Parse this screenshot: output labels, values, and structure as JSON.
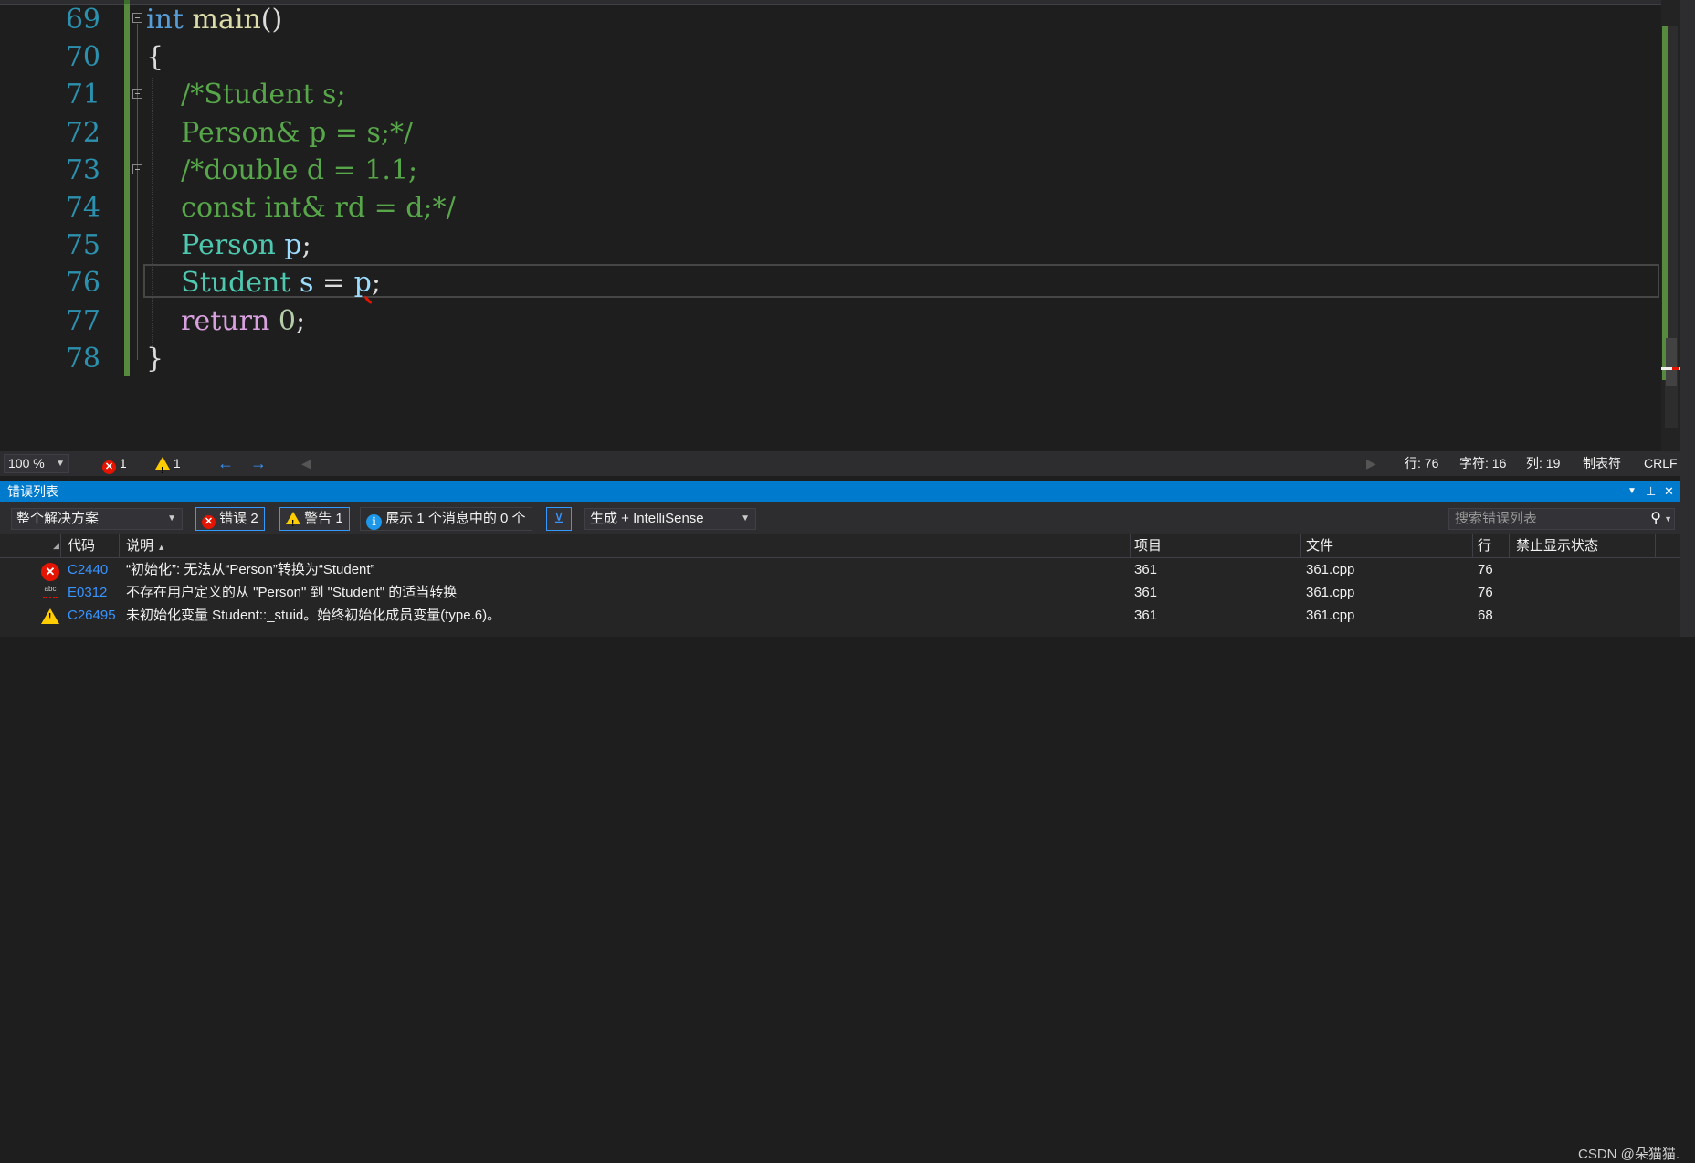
{
  "editor": {
    "lines": [
      {
        "num": "69",
        "tokens": [
          {
            "t": "int",
            "c": "kw"
          },
          {
            "t": " ",
            "c": ""
          },
          {
            "t": "main",
            "c": "fn"
          },
          {
            "t": "()",
            "c": ""
          }
        ]
      },
      {
        "num": "70",
        "tokens": [
          {
            "t": "{",
            "c": ""
          }
        ]
      },
      {
        "num": "71",
        "tokens": [
          {
            "t": "    /*Student s;",
            "c": "cm"
          }
        ]
      },
      {
        "num": "72",
        "tokens": [
          {
            "t": "    Person& p = s;*/",
            "c": "cm"
          }
        ]
      },
      {
        "num": "73",
        "tokens": [
          {
            "t": "    /*double d = 1.1;",
            "c": "cm"
          }
        ]
      },
      {
        "num": "74",
        "tokens": [
          {
            "t": "    const int& rd = d;*/",
            "c": "cm"
          }
        ]
      },
      {
        "num": "75",
        "tokens": [
          {
            "t": "    ",
            "c": ""
          },
          {
            "t": "Person",
            "c": "ty"
          },
          {
            "t": " ",
            "c": ""
          },
          {
            "t": "p",
            "c": "var"
          },
          {
            "t": ";",
            "c": ""
          }
        ]
      },
      {
        "num": "76",
        "tokens": [
          {
            "t": "    ",
            "c": ""
          },
          {
            "t": "Student",
            "c": "ty"
          },
          {
            "t": " ",
            "c": ""
          },
          {
            "t": "s",
            "c": "var"
          },
          {
            "t": " = ",
            "c": ""
          },
          {
            "t": "p",
            "c": "var"
          },
          {
            "t": ";",
            "c": ""
          }
        ]
      },
      {
        "num": "77",
        "tokens": [
          {
            "t": "    ",
            "c": ""
          },
          {
            "t": "return",
            "c": "ctl"
          },
          {
            "t": " ",
            "c": ""
          },
          {
            "t": "0",
            "c": "num"
          },
          {
            "t": ";",
            "c": ""
          }
        ]
      },
      {
        "num": "78",
        "tokens": [
          {
            "t": "}",
            "c": ""
          }
        ]
      }
    ]
  },
  "statusbar": {
    "zoom": "100 %",
    "errors": "1",
    "warnings": "1",
    "line": "行: 76",
    "char": "字符: 16",
    "col": "列: 19",
    "tabs": "制表符",
    "eol": "CRLF"
  },
  "panel": {
    "title": "错误列表",
    "scope": "整个解决方案",
    "errors_btn": "错误 2",
    "warnings_btn": "警告 1",
    "messages_btn": "展示 1 个消息中的 0 个",
    "source": "生成 + IntelliSense",
    "search_placeholder": "搜索错误列表"
  },
  "grid": {
    "headers": {
      "code": "代码",
      "desc": "说明",
      "project": "项目",
      "file": "文件",
      "line": "行",
      "suppress": "禁止显示状态"
    },
    "rows": [
      {
        "icon": "error",
        "code": "C2440",
        "desc": "“初始化”: 无法从“Person”转换为“Student”",
        "project": "361",
        "file": "361.cpp",
        "line": "76"
      },
      {
        "icon": "abc",
        "icon_text": "abc",
        "code": "E0312",
        "desc": "不存在用户定义的从 \"Person\" 到 \"Student\" 的适当转换",
        "project": "361",
        "file": "361.cpp",
        "line": "76"
      },
      {
        "icon": "warning",
        "code": "C26495",
        "desc": "未初始化变量 Student::_stuid。始终初始化成员变量(type.6)。",
        "project": "361",
        "file": "361.cpp",
        "line": "68"
      }
    ]
  },
  "watermark": "CSDN @朵猫猫."
}
